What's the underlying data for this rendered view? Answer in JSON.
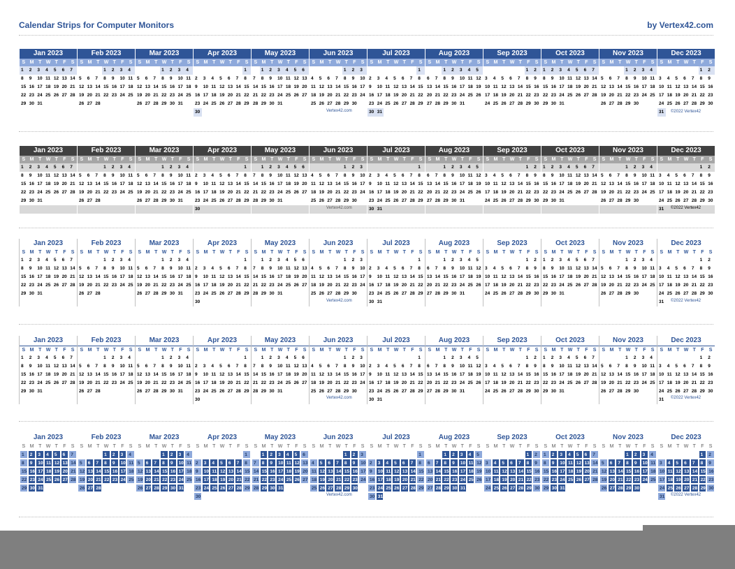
{
  "header": {
    "title": "Calendar Strips for Computer Monitors",
    "byline": "by Vertex42.com"
  },
  "weekdays": [
    "S",
    "M",
    "T",
    "W",
    "T",
    "F",
    "S"
  ],
  "months": [
    {
      "name": "Jan 2023",
      "start": 0,
      "days": 31
    },
    {
      "name": "Feb 2023",
      "start": 3,
      "days": 28
    },
    {
      "name": "Mar 2023",
      "start": 3,
      "days": 31
    },
    {
      "name": "Apr 2023",
      "start": 6,
      "days": 30
    },
    {
      "name": "May 2023",
      "start": 1,
      "days": 31
    },
    {
      "name": "Jun 2023",
      "start": 4,
      "days": 30
    },
    {
      "name": "Jul 2023",
      "start": 6,
      "days": 31
    },
    {
      "name": "Aug 2023",
      "start": 2,
      "days": 31
    },
    {
      "name": "Sep 2023",
      "start": 5,
      "days": 30
    },
    {
      "name": "Oct 2023",
      "start": 0,
      "days": 31
    },
    {
      "name": "Nov 2023",
      "start": 3,
      "days": 30
    },
    {
      "name": "Dec 2023",
      "start": 5,
      "days": 31
    }
  ],
  "strips": [
    {
      "style": "blue-header",
      "footer_link": "Vertex42.com",
      "footer_copyright": "©2022 Vertex42"
    },
    {
      "style": "gray-header",
      "footer_link": "Vertex42.com",
      "footer_copyright": "©2022 Vertex42"
    },
    {
      "style": "minimal-line",
      "footer_link": "Vertex42.com",
      "footer_copyright": "©2022 Vertex42"
    },
    {
      "style": "minimal-underline",
      "footer_link": "Vertex42.com",
      "footer_copyright": "©2022 Vertex42"
    },
    {
      "style": "blue-blocks",
      "footer_link": "Vertex42.com",
      "footer_copyright": "©2022 Vertex42"
    }
  ],
  "colors": {
    "accent": "#2F5597",
    "light_band": "#D9E1F2",
    "gray_header": "#404040",
    "block": "#2F5597",
    "block_light": "#8EA9DB"
  }
}
